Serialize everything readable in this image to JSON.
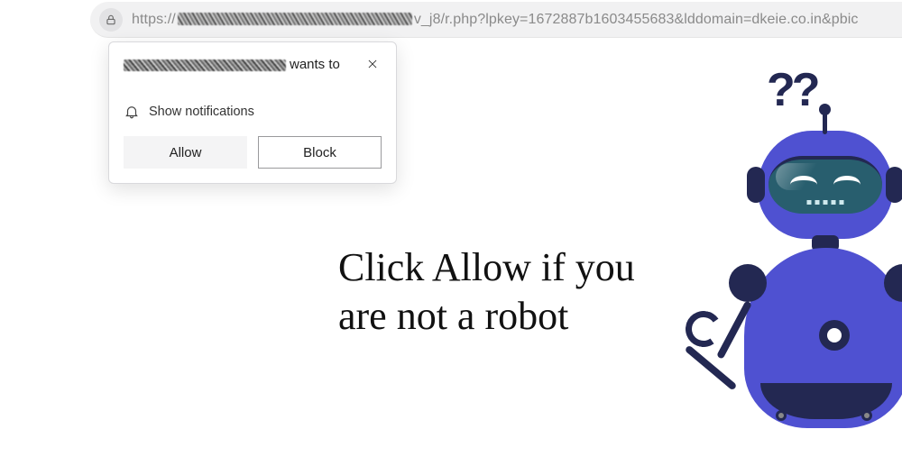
{
  "address_bar": {
    "url_prefix": "https://",
    "url_suffix": "v_j8/r.php?lpkey=1672887b1603455683&lddomain=dkeie.co.in&pbic"
  },
  "permission_popup": {
    "wants_to": "wants to",
    "notification_label": "Show notifications",
    "allow_label": "Allow",
    "block_label": "Block"
  },
  "page": {
    "heading": "Click Allow if you are not a robot",
    "question_marks": "??"
  }
}
